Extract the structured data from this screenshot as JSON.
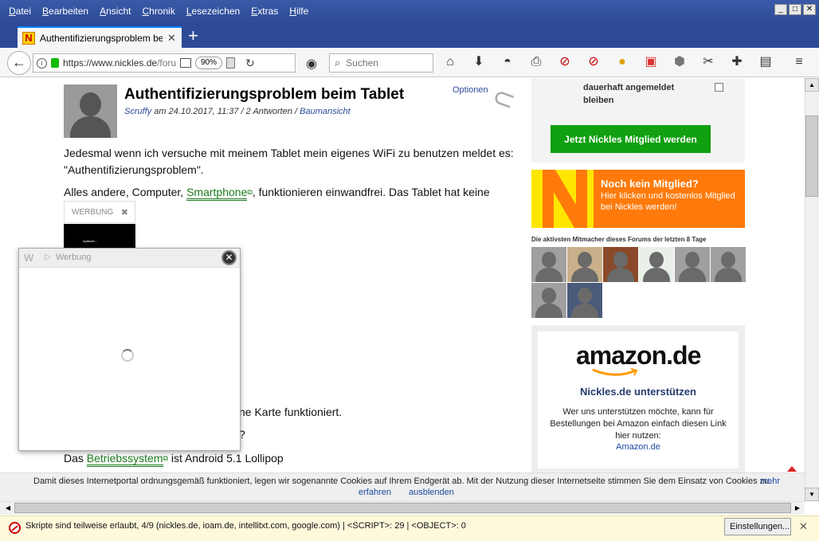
{
  "menubar": {
    "items": [
      {
        "pre": "",
        "key": "D",
        "post": "atei"
      },
      {
        "pre": "",
        "key": "B",
        "post": "earbeiten"
      },
      {
        "pre": "",
        "key": "A",
        "post": "nsicht"
      },
      {
        "pre": "",
        "key": "C",
        "post": "hronik"
      },
      {
        "pre": "",
        "key": "L",
        "post": "esezeichen"
      },
      {
        "pre": "",
        "key": "E",
        "post": "xtras"
      },
      {
        "pre": "",
        "key": "H",
        "post": "ilfe"
      }
    ]
  },
  "window_controls": {
    "minimize": "_",
    "maximize": "□",
    "close": "✕"
  },
  "tab": {
    "favicon": "N",
    "title": "Authentifizierungsproblem beim",
    "close": "✕"
  },
  "newtab": "+",
  "urlbar": {
    "url_host": "https://www.nickles.de",
    "url_path": "/forum",
    "zoom": "90%"
  },
  "search": {
    "placeholder": "Suchen"
  },
  "toolbar_icons": [
    "home-icon",
    "download-icon",
    "mask-icon",
    "print-icon",
    "noscript-icon",
    "noscript-settings-icon",
    "color-icon",
    "screenshot-icon",
    "ublock-icon",
    "cut-icon",
    "extensions-icon",
    "sidebar-icon",
    "hamburger-menu-icon"
  ],
  "article": {
    "title": "Authentifizierungsproblem beim Tablet",
    "author": "Scruffy",
    "meta_mid": " am 24.10.2017, 11:37 / 2 Antworten / ",
    "thread_view": "Baumansicht",
    "options": "Optionen",
    "para1_line1": "Jedesmal wenn ich versuche mit meinem Tablet mein eigenes WiFi zu benutzen meldet es:",
    "para1_line2": "\"Authentifizierungsproblem\".",
    "para2_pre": "Alles andere, Computer, ",
    "para2_link": "Smartphone",
    "para2_post": ", funktionieren einwandfrei. Das Tablet hat keine",
    "para3_tail": "ne Karte funktioniert.",
    "para4_tail": "?",
    "para5_pre": "Das ",
    "para5_link": "Betriebssystem",
    "para5_post": " ist Android 5.1 Lollipop"
  },
  "inline_ad": {
    "label": "WERBUNG",
    "close": "✖",
    "tiny_text": "Aptitude..."
  },
  "popup_ad": {
    "logo": "W",
    "play": "▷",
    "label": "Werbung",
    "close": "✕"
  },
  "sidebar": {
    "remember_label": "dauerhaft angemeldet bleiben",
    "join_button": "Jetzt Nickles Mitglied werden",
    "banner_title": "Noch kein Mitglied?",
    "banner_text": "Hier klicken und kostenlos Mitglied bei Nickles werden!",
    "active_label": "Die aktivsten Mitmacher dieses Forums der letzten 8 Tage",
    "members_count_row1": 6,
    "members_count_row2": 2,
    "amazon_logo_main": "amazon",
    "amazon_logo_suffix": ".de",
    "amazon_heading": "Nickles.de unterstützen",
    "amazon_text": "Wer uns unterstützen möchte, kann für Bestellungen bei Amazon einfach diesen Link hier nutzen:",
    "amazon_link": "Amazon.de"
  },
  "cookiebar": {
    "text": "Damit dieses Internetportal ordnungsgemäß funktioniert, legen wir sogenannte Cookies auf Ihrem Endgerät ab. Mit der Nutzung dieser Internetseite stimmen Sie dem Einsatz von Cookies zu.",
    "more_1": "mehr",
    "more_2": "erfahren",
    "hide": "ausblenden"
  },
  "notification": {
    "text": "Skripte sind teilweise erlaubt, 4/9 (nickles.de, ioam.de, intellitxt.com, google.com) | <SCRIPT>: 29 | <OBJECT>: 0",
    "settings_button": "Einstellungen...",
    "close": "✕"
  },
  "colors": {
    "accent_green": "#10a010",
    "banner_orange": "#ff7a0a",
    "banner_yellow": "#ffe600",
    "link_blue": "#1a4aa0",
    "titlebar": "#2c4a96"
  }
}
